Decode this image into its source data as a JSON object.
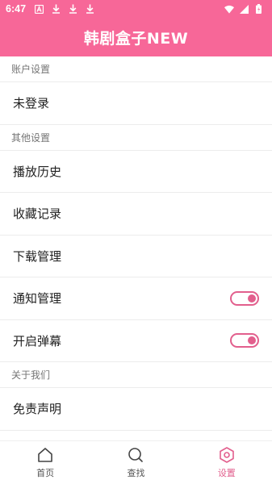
{
  "status_bar": {
    "time": "6:47",
    "icons": [
      "a-box-icon",
      "download-icon",
      "download-icon",
      "download-icon"
    ],
    "right_icons": [
      "wifi-icon",
      "signal-icon",
      "battery-icon"
    ]
  },
  "app_bar": {
    "title": "韩剧盒子NEW"
  },
  "sections": {
    "account": {
      "header": "账户设置",
      "login_label": "未登录"
    },
    "other": {
      "header": "其他设置",
      "history_label": "播放历史",
      "favorites_label": "收藏记录",
      "downloads_label": "下载管理",
      "notifications_label": "通知管理",
      "danmaku_label": "开启弹幕"
    },
    "about": {
      "header": "关于我们",
      "disclaimer_label": "免责声明"
    }
  },
  "toggles": {
    "notifications_on": true,
    "danmaku_on": true
  },
  "bottom_nav": {
    "home_label": "首页",
    "search_label": "查找",
    "settings_label": "设置",
    "active": "设置"
  },
  "colors": {
    "brand": "#f76798",
    "accent": "#e25f8d"
  }
}
